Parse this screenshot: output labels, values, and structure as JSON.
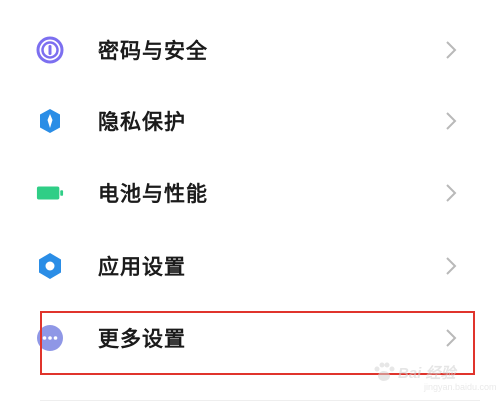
{
  "colors": {
    "password_icon": "#7c6ff0",
    "privacy_icon": "#2a8de6",
    "battery_icon": "#2fce86",
    "app_settings_icon": "#2a8de6",
    "more_settings_icon": "#8f97e6",
    "highlight_border": "#e0342c"
  },
  "settings": {
    "items": [
      {
        "label": "密码与安全",
        "icon": "fingerprint-icon"
      },
      {
        "label": "隐私保护",
        "icon": "privacy-shield-icon"
      },
      {
        "label": "电池与性能",
        "icon": "battery-icon"
      },
      {
        "label": "应用设置",
        "icon": "gear-icon"
      },
      {
        "label": "更多设置",
        "icon": "more-dots-icon"
      }
    ]
  },
  "watermark": {
    "text": "Bai 经验",
    "sub": "jingyan.baidu.com"
  }
}
